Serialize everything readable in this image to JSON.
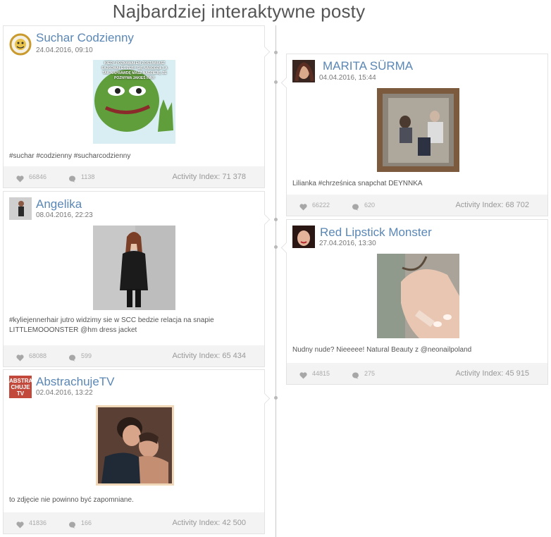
{
  "page": {
    "title": "Najbardziej interaktywne posty"
  },
  "posts": [
    {
      "author": "Suchar Codzienny",
      "date": "24.04.2016, 09:10",
      "image_text": "KIEDY POZNAWAŁEM ZOSTAWIASZ FAJSOWAŁEŚ ŻEBY SIĘ NARODZIŁ? A TAK NAPRAWDĘ MASZ NADZIEJĘ, ŻE POZNYWA JAKIEŚ INNY",
      "caption": "#suchar #codzienny #sucharcodzienny",
      "likes": "66846",
      "comments": "1138",
      "activity_index": "Activity Index: 71 378"
    },
    {
      "author": "Angelika",
      "date": "08.04.2016, 22:23",
      "caption": "#kyliejennerhair jutro widzimy sie w SCC bedzie relacja na snapie LITTLEMOOONSTER @hm dress jacket",
      "likes": "68088",
      "comments": "599",
      "activity_index": "Activity Index: 65 434"
    },
    {
      "author": "AbstrachujeTV",
      "date": "02.04.2016, 13:22",
      "avatar_text": "ABSTRA CHUJE TV",
      "caption": "to zdjęcie nie powinno być zapomniane.",
      "likes": "41836",
      "comments": "166",
      "activity_index": "Activity Index: 42 500"
    },
    {
      "author": "MARITA SÜRMA",
      "date": "04.04.2016, 15:44",
      "caption": "Lilianka #chrześnica snapchat DEYNNKA",
      "likes": "66222",
      "comments": "620",
      "activity_index": "Activity Index: 68 702"
    },
    {
      "author": "Red Lipstick Monster",
      "date": "27.04.2016, 13:30",
      "caption": "Nudny nude? Nieeeee!  Natural Beauty z @neonailpoland",
      "likes": "44815",
      "comments": "275",
      "activity_index": "Activity Index: 45 915"
    }
  ],
  "icons": {
    "like": "heart-icon",
    "comment": "comment-icon"
  },
  "colors": {
    "author_link": "#5a87b5",
    "footer_bg": "#f3f3f3",
    "timeline": "#c9c9c9"
  }
}
